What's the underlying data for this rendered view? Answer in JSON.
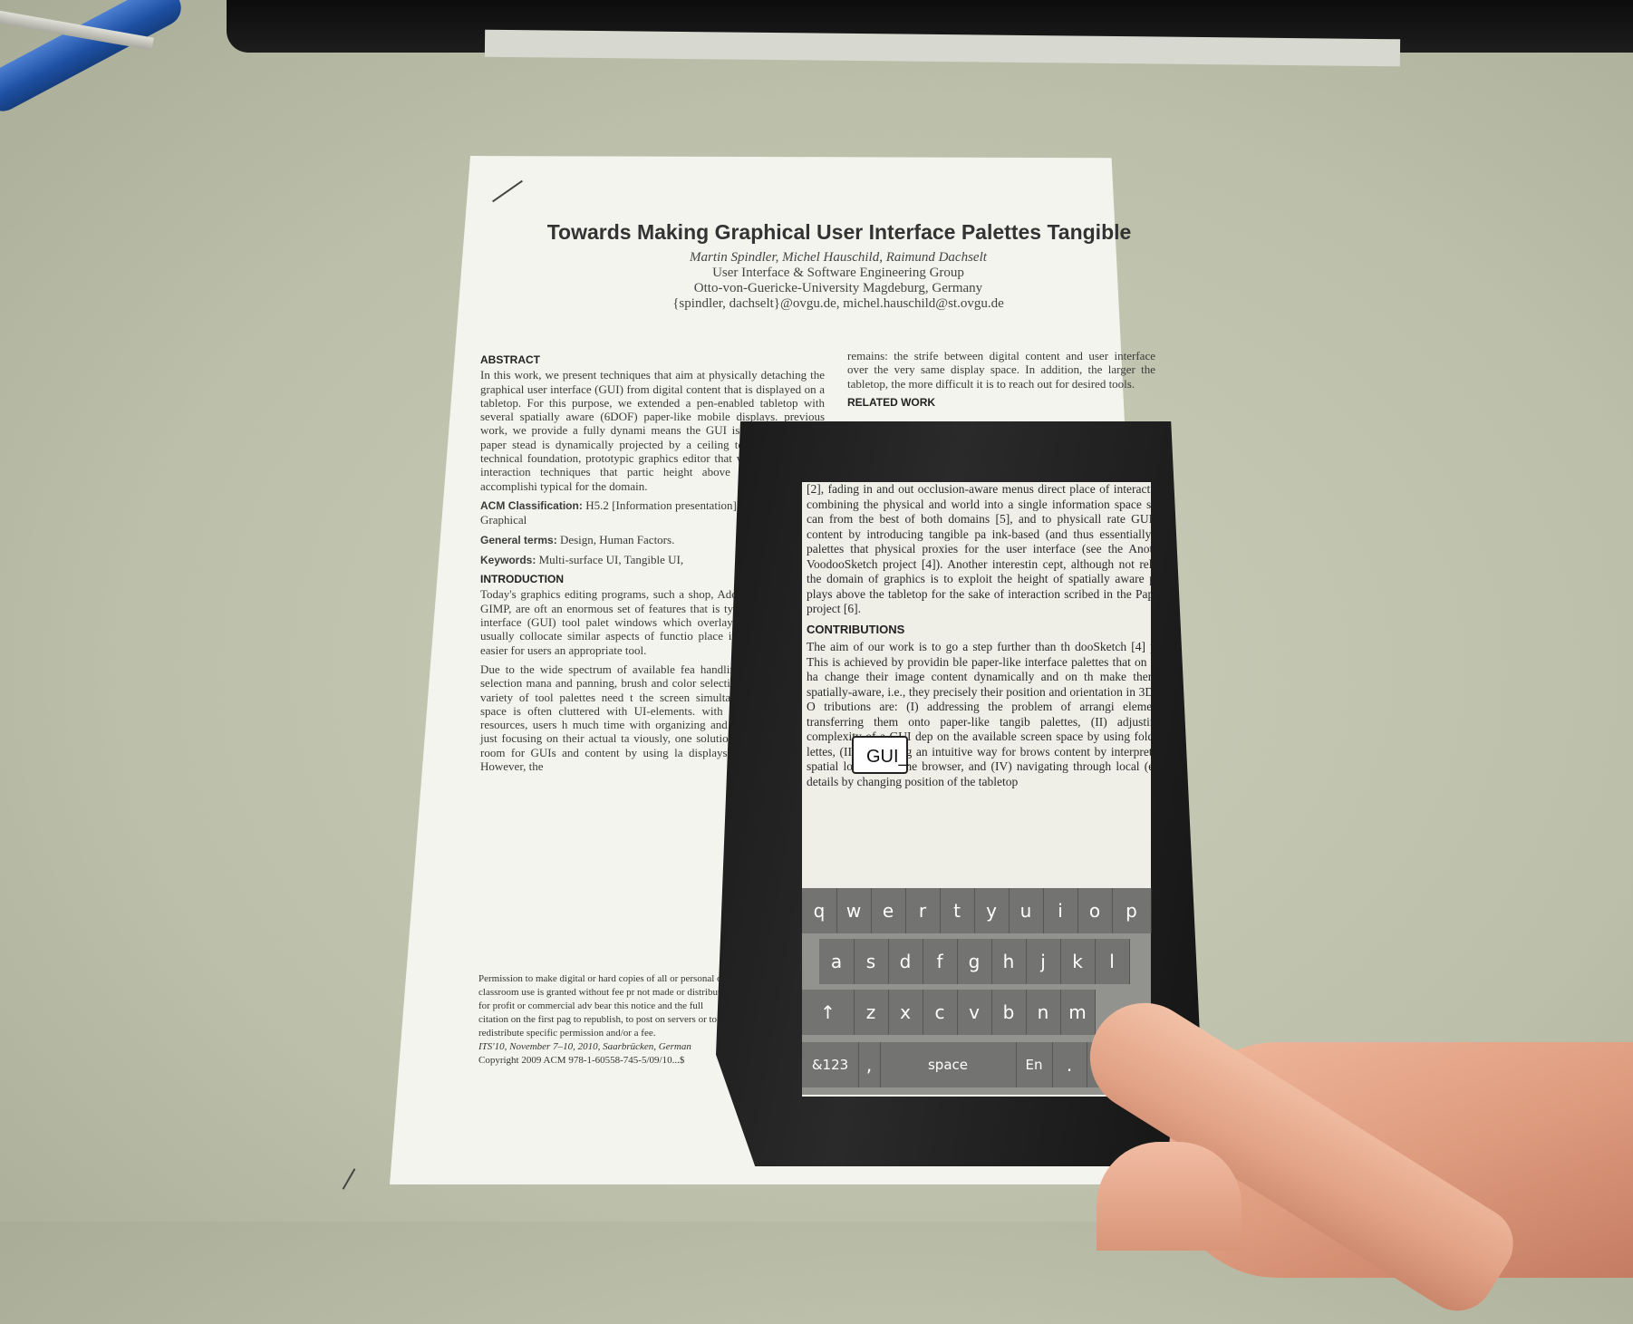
{
  "paper": {
    "title": "Towards Making Graphical User Interface Palettes Tangible",
    "authors": "Martin Spindler, Michel Hauschild, Raimund Dachselt",
    "affiliation_1": "User Interface & Software Engineering Group",
    "affiliation_2": "Otto-von-Guericke-University Magdeburg, Germany",
    "emails": "{spindler, dachselt}@ovgu.de, michel.hauschild@st.ovgu.de",
    "abstract_heading": "ABSTRACT",
    "abstract_text": "In this work, we present techniques that aim at physically detaching the graphical user interface (GUI) from digital content that is displayed on a tabletop. For this purpose, we extended a pen-enabled tabletop with several spatially aware (6DOF) paper-like mobile displays. previous work, we provide a fully dynami means the GUI is not printed onto paper stead is dynamically projected by a ceiling tor. Based on this technical foundation, prototypic graphics editor that we use as a novel interaction techniques that partic height above the tabletop for accomplishi typical for the domain.",
    "acm_label": "ACM Classification:",
    "acm_text": "H5.2 [Information presentation]: User Interfaces. - Graphical",
    "general_label": "General terms:",
    "general_text": "Design, Human Factors.",
    "keywords_label": "Keywords:",
    "keywords_text": "Multi-surface UI, Tangible UI,",
    "intro_heading": "INTRODUCTION",
    "intro_p1": "Today's graphics editing programs, such a shop, Adobe® Illustrator, or GIMP, are oft an enormous set of features that is typica graphical user interface (GUI) tool palet windows which overlay all regular windo usually collocate similar aspects of functio place in order to make it easier for users an appropriate tool.",
    "intro_p2": "Due to the wide spectrum of available fea handling, system control, selection mana and panning, brush and color selection, sli tion, etc. – a variety of tool palettes need t the screen simultaneously. Therefore, space is often cluttered with UI-elements. with the limited display resources, users h much time with organizing and rearrang instead of just focusing on their actual ta viously, one solution to this problem is room for GUIs and content by using la displays, such as tabletops. However, the",
    "footnote_1": "Permission to make digital or hard copies of all or personal or classroom use is granted without fee pr not made or distributed for profit or commercial adv bear this notice and the full citation on the first pag to republish, to post on servers or to redistribute specific permission and/or a fee.",
    "footnote_2": "ITS'10, November 7–10, 2010, Saarbrücken, German",
    "footnote_3": "Copyright 2009 ACM 978-1-60558-745-5/09/10...$",
    "right_p1": "remains: the strife between digital content and user interface over the very same display space. In addition, the larger the tabletop, the more difficult it is to reach out for desired tools.",
    "related_heading": "RELATED WORK"
  },
  "device": {
    "screen_p1": "[2], fading in and out occlusion-aware menus direct place of interaction [3], combining the physical and world into a single information space so users can from the best of both domains [5], and to physicall rate GUIs from content by introducing tangible pa ink-based (and thus essentially static) palettes that physical proxies for the user interface (see the Anot based VoodooSketch project [4]). Another interestin cept, although not related to the domain of graphics is to exploit the height of spatially aware paper-li plays above the tabletop for the sake of interaction scribed in the PaperLens project [6].",
    "contrib_heading": "CONTRIBUTIONS",
    "screen_p2": "The aim of our work is to go a step further than th dooSketch [4] project. This is achieved by providin ble paper-like interface palettes that on the one ha change their image content dynamically and on th make them fully spatially-aware, i.e., they precisely their position and orientation in 3D space. O tributions are: (I) addressing the problem of arrangi elements by transferring them onto paper-like tangib palettes, (II) adjusting the complexity of a GUI dep on the available screen space by using foldable G lettes, (III) providing an intuitive way for brows content by interpreting the spatial location of the browser, and (IV) navigating through local (editable details by changing position of the tabletop",
    "text_field_value": "GUI_",
    "keyboard": {
      "row1": [
        "q",
        "w",
        "e",
        "r",
        "t",
        "y",
        "u",
        "i",
        "o",
        "p"
      ],
      "row2": [
        "a",
        "s",
        "d",
        "f",
        "g",
        "h",
        "j",
        "k",
        "l"
      ],
      "row3": [
        "↑",
        "z",
        "x",
        "c",
        "v",
        "b",
        "n",
        "m"
      ],
      "row4": [
        "&123",
        ",",
        "space",
        "En",
        ".",
        "↵"
      ]
    }
  }
}
